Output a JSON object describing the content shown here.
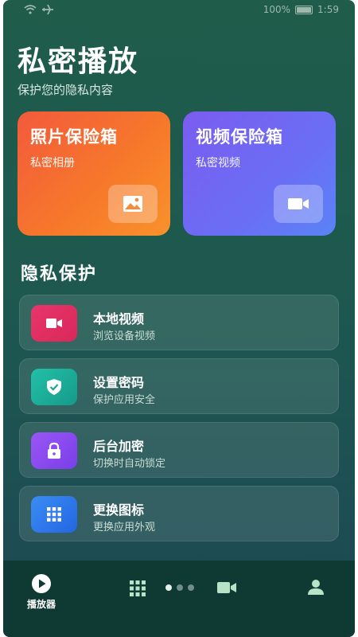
{
  "status_bar": {
    "battery_text": "100%",
    "time": "1:59"
  },
  "header": {
    "title": "私密播放",
    "subtitle": "保护您的隐私内容"
  },
  "vaults": [
    {
      "title": "照片保险箱",
      "subtitle": "私密相册",
      "icon": "image-icon"
    },
    {
      "title": "视频保险箱",
      "subtitle": "私密视频",
      "icon": "video-camera-icon"
    }
  ],
  "section": {
    "title": "隐私保护"
  },
  "items": [
    {
      "title": "本地视频",
      "subtitle": "浏览设备视频",
      "icon": "video-camera-icon",
      "color": "#e8356a"
    },
    {
      "title": "设置密码",
      "subtitle": "保护应用安全",
      "icon": "shield-check-icon",
      "color": "#1fb5a0"
    },
    {
      "title": "后台加密",
      "subtitle": "切换时自动锁定",
      "icon": "lock-icon",
      "color": "#8a4cf0"
    },
    {
      "title": "更换图标",
      "subtitle": "更换应用外观",
      "icon": "grid-icon",
      "color": "#2f7ef0"
    }
  ],
  "nav": {
    "player_label": "播放器",
    "accent": "#b7e4c7"
  }
}
